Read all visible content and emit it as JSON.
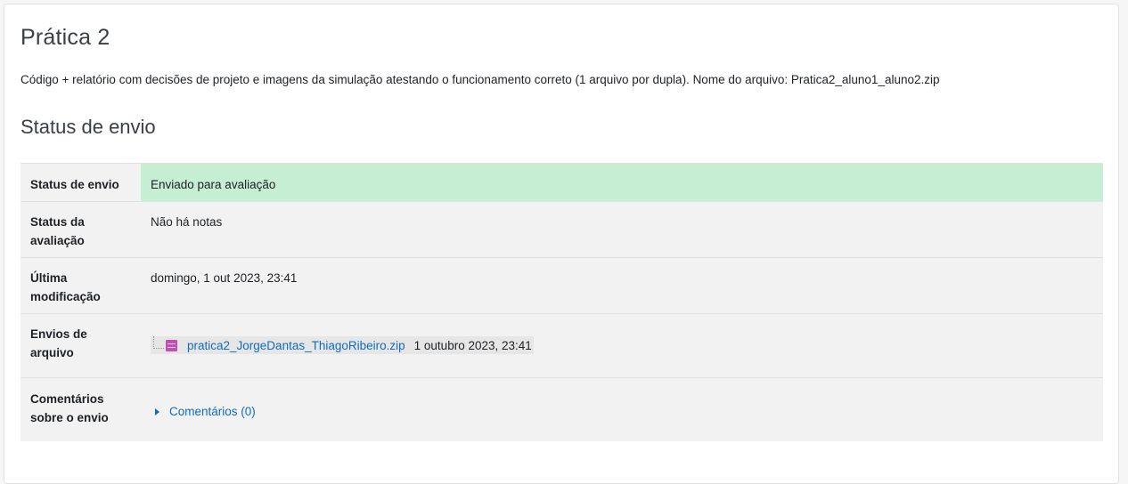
{
  "assignment": {
    "title": "Prática 2",
    "description": "Código + relatório com decisões de projeto e imagens da simulação atestando o funcionamento correto (1 arquivo por dupla). Nome do arquivo: Pratica2_aluno1_aluno2.zip"
  },
  "submission_status": {
    "heading": "Status de envio",
    "rows": {
      "submission": {
        "label": "Status de envio",
        "value": "Enviado para avaliação"
      },
      "grading": {
        "label": "Status da avaliação",
        "value": "Não há notas"
      },
      "last_modified": {
        "label": "Última modificação",
        "value": "domingo, 1 out 2023, 23:41"
      },
      "files": {
        "label": "Envios de arquivo",
        "file_name": "pratica2_JorgeDantas_ThiagoRibeiro.zip",
        "file_date": "1 outubro 2023, 23:41",
        "file_icon": "zip-file-icon"
      },
      "comments": {
        "label": "Comentários sobre o envio",
        "link": "Comentários (0)",
        "icon": "caret-right-icon"
      }
    }
  },
  "colors": {
    "submitted_bg": "#c5eed3",
    "link": "#0f6cbf",
    "row_alt": "#f2f2f2"
  }
}
